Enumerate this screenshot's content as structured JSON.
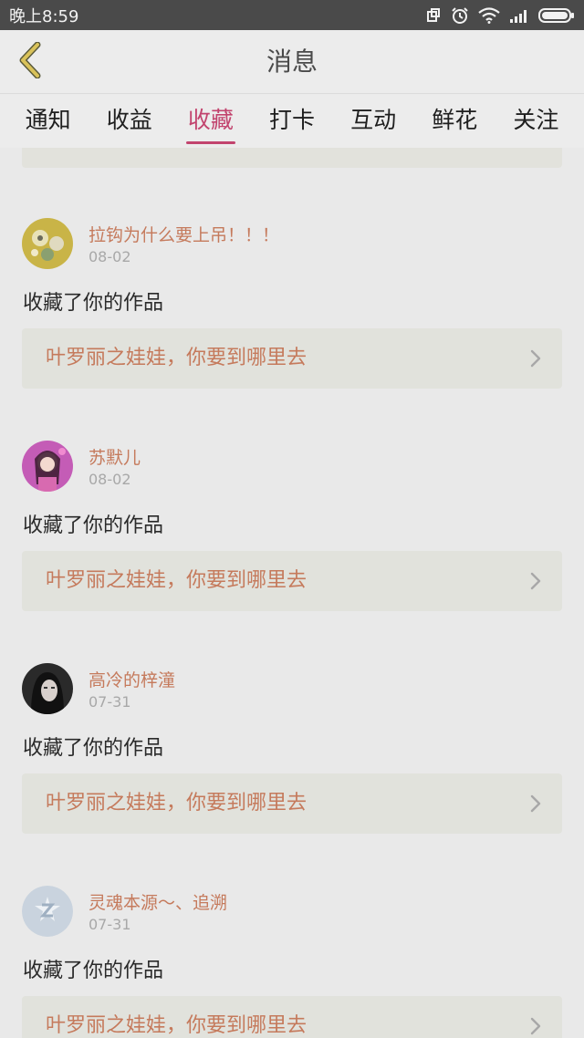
{
  "status_bar": {
    "time": "晚上8:59",
    "icons": [
      "rotate-icon",
      "alarm-icon",
      "wifi-icon",
      "signal-icon",
      "battery-icon"
    ]
  },
  "header": {
    "title": "消息",
    "back_icon": "chevron-left-icon",
    "back_color": "#d9c25a"
  },
  "tabs": [
    {
      "label": "通知",
      "active": false
    },
    {
      "label": "收益",
      "active": false
    },
    {
      "label": "收藏",
      "active": true
    },
    {
      "label": "打卡",
      "active": false
    },
    {
      "label": "互动",
      "active": false
    },
    {
      "label": "鲜花",
      "active": false
    },
    {
      "label": "关注",
      "active": false
    }
  ],
  "colors": {
    "accent": "#c2446e",
    "name": "#c57a5c",
    "date": "#a8a8a8"
  },
  "items": [
    {
      "user": "拉钩为什么要上吊！！！",
      "date": "08-02",
      "action": "收藏了你的作品",
      "work": "叶罗丽之娃娃，你要到哪里去",
      "avatar": "avatar-yellow-cartoon"
    },
    {
      "user": "苏默儿",
      "date": "08-02",
      "action": "收藏了你的作品",
      "work": "叶罗丽之娃娃，你要到哪里去",
      "avatar": "avatar-pink-girl"
    },
    {
      "user": "高冷的梓潼",
      "date": "07-31",
      "action": "收藏了你的作品",
      "work": "叶罗丽之娃娃，你要到哪里去",
      "avatar": "avatar-dark-girl"
    },
    {
      "user": "灵魂本源～、追溯",
      "date": "07-31",
      "action": "收藏了你的作品",
      "work": "叶罗丽之娃娃，你要到哪里去",
      "avatar": "avatar-default-qq"
    }
  ]
}
